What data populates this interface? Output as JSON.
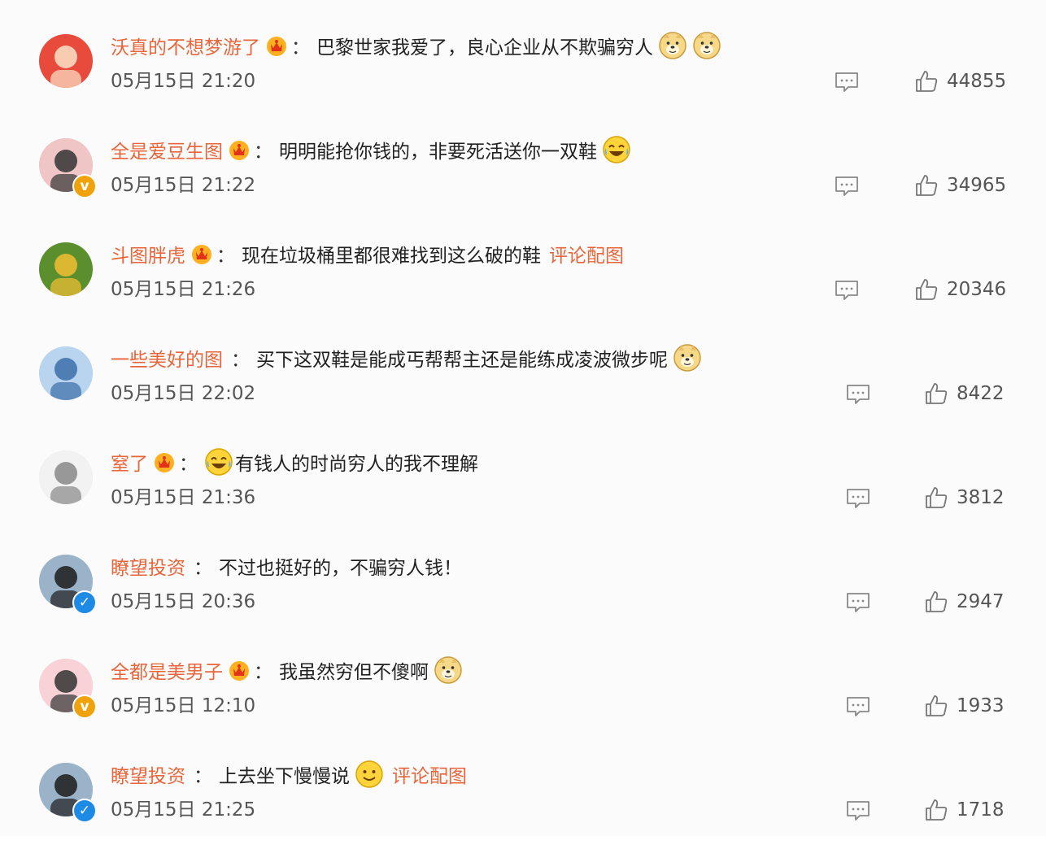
{
  "comments": [
    {
      "user": "沃真的不想梦游了",
      "crown": true,
      "badge": "",
      "text": "巴黎世家我爱了，良心企业从不欺骗穷人",
      "emojis": [
        "doge",
        "doge"
      ],
      "pic": "",
      "time": "05月15日 21:20",
      "likes": "44855"
    },
    {
      "user": "全是爱豆生图",
      "crown": true,
      "badge": "gold",
      "text": "明明能抢你钱的，非要死活送你一双鞋",
      "emojis": [
        "laugh-cry"
      ],
      "pic": "",
      "time": "05月15日 21:22",
      "likes": "34965"
    },
    {
      "user": "斗图胖虎",
      "crown": true,
      "badge": "",
      "text": "现在垃圾桶里都很难找到这么破的鞋",
      "emojis": [],
      "pic": "评论配图",
      "time": "05月15日 21:26",
      "likes": "20346"
    },
    {
      "user": "一些美好的图",
      "crown": false,
      "badge": "",
      "text": "买下这双鞋是能成丐帮帮主还是能练成凌波微步呢",
      "emojis": [
        "doge"
      ],
      "pic": "",
      "time": "05月15日 22:02",
      "likes": "8422"
    },
    {
      "user": "窒了",
      "crown": true,
      "badge": "",
      "text": "有钱人的时尚穷人的我不理解",
      "emojis": [],
      "lead_emoji": "laugh-cry",
      "pic": "",
      "time": "05月15日 21:36",
      "likes": "3812"
    },
    {
      "user": "瞭望投资",
      "crown": false,
      "badge": "blue",
      "text": "不过也挺好的，不骗穷人钱！",
      "emojis": [],
      "pic": "",
      "time": "05月15日 20:36",
      "likes": "2947"
    },
    {
      "user": "全都是美男子",
      "crown": true,
      "badge": "gold",
      "text": "我虽然穷但不傻啊",
      "emojis": [
        "doge"
      ],
      "pic": "",
      "time": "05月15日 12:10",
      "likes": "1933"
    },
    {
      "user": "瞭望投资",
      "crown": false,
      "badge": "blue",
      "text": "上去坐下慢慢说",
      "emojis": [
        "smile"
      ],
      "pic": "评论配图",
      "time": "05月15日 21:25",
      "likes": "1718"
    }
  ],
  "colon": "："
}
